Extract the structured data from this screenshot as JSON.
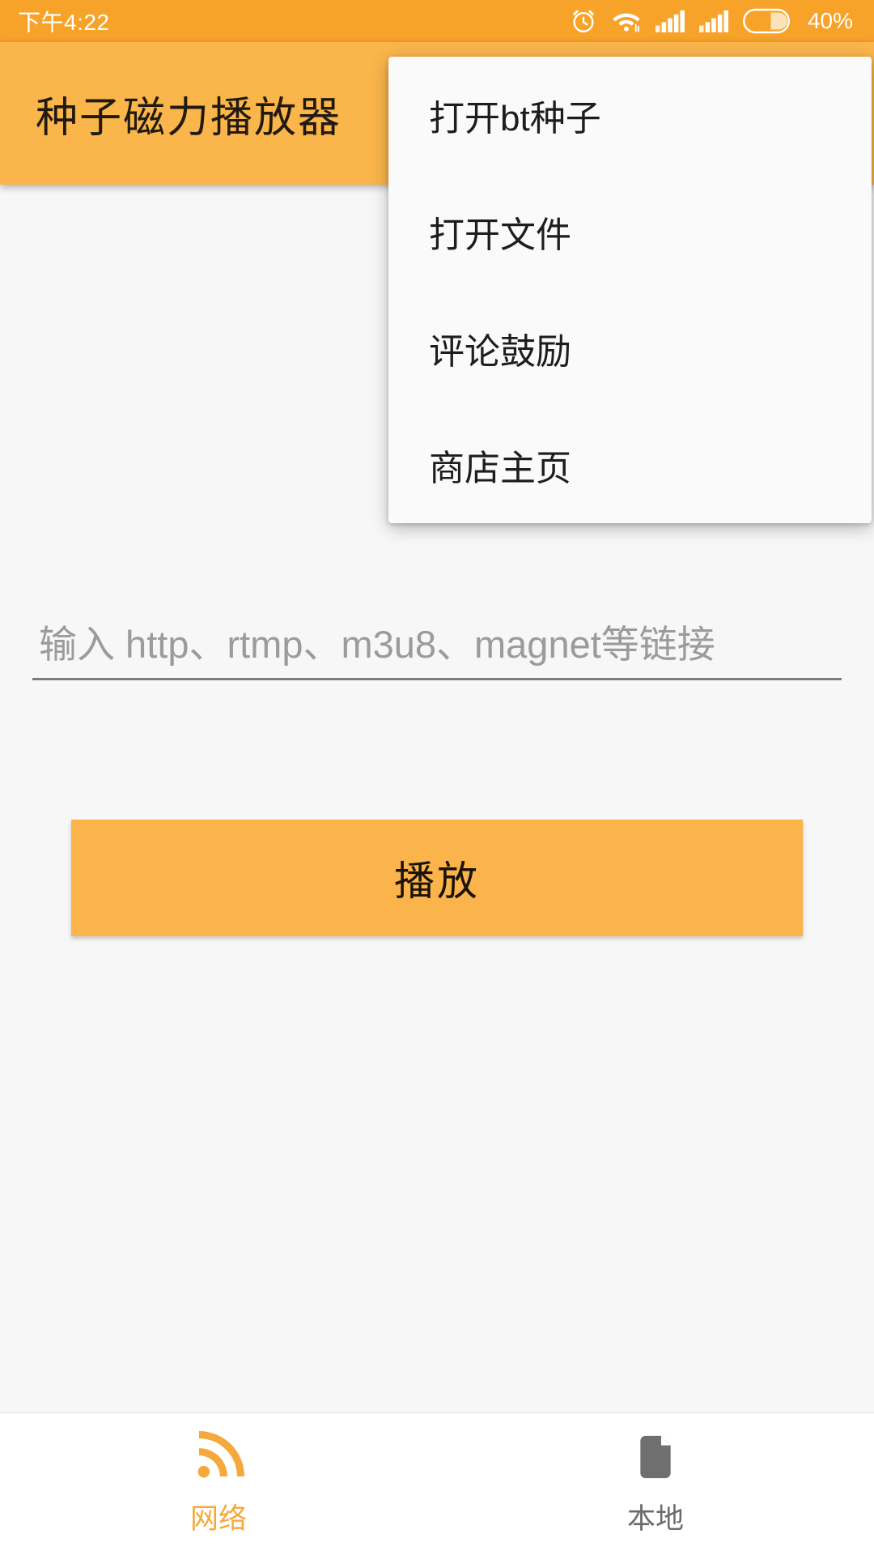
{
  "status_bar": {
    "time": "下午4:22",
    "battery_percent": "40%",
    "icons": [
      "alarm-icon",
      "wifi-icon",
      "signal-icon-1",
      "signal-icon-2",
      "battery-icon"
    ],
    "background_color": "#f7a32a",
    "text_color": "#ffffff"
  },
  "toolbar": {
    "title": "种子磁力播放器",
    "background_color": "#fab54b",
    "title_color": "#211a11"
  },
  "overflow_menu": {
    "visible": true,
    "background_color": "#fafafa",
    "items": [
      {
        "label": "打开bt种子"
      },
      {
        "label": "打开文件"
      },
      {
        "label": "评论鼓励"
      },
      {
        "label": "商店主页"
      }
    ]
  },
  "main": {
    "url_input": {
      "value": "",
      "placeholder": "输入 http、rtmp、m3u8、magnet等链接",
      "placeholder_color": "#9b9b9b",
      "underline_color": "#7c7c7c"
    },
    "play_button": {
      "label": "播放",
      "background_color": "#fbb34b",
      "label_color": "#191308"
    },
    "background_color": "#f7f7f7"
  },
  "bottom_nav": {
    "background_color": "#ffffff",
    "active_color": "#f5a93c",
    "inactive_color": "#6b6b6b",
    "tabs": [
      {
        "label": "网络",
        "icon": "rss-signal-icon",
        "active": true
      },
      {
        "label": "本地",
        "icon": "file-document-icon",
        "active": false
      }
    ]
  }
}
